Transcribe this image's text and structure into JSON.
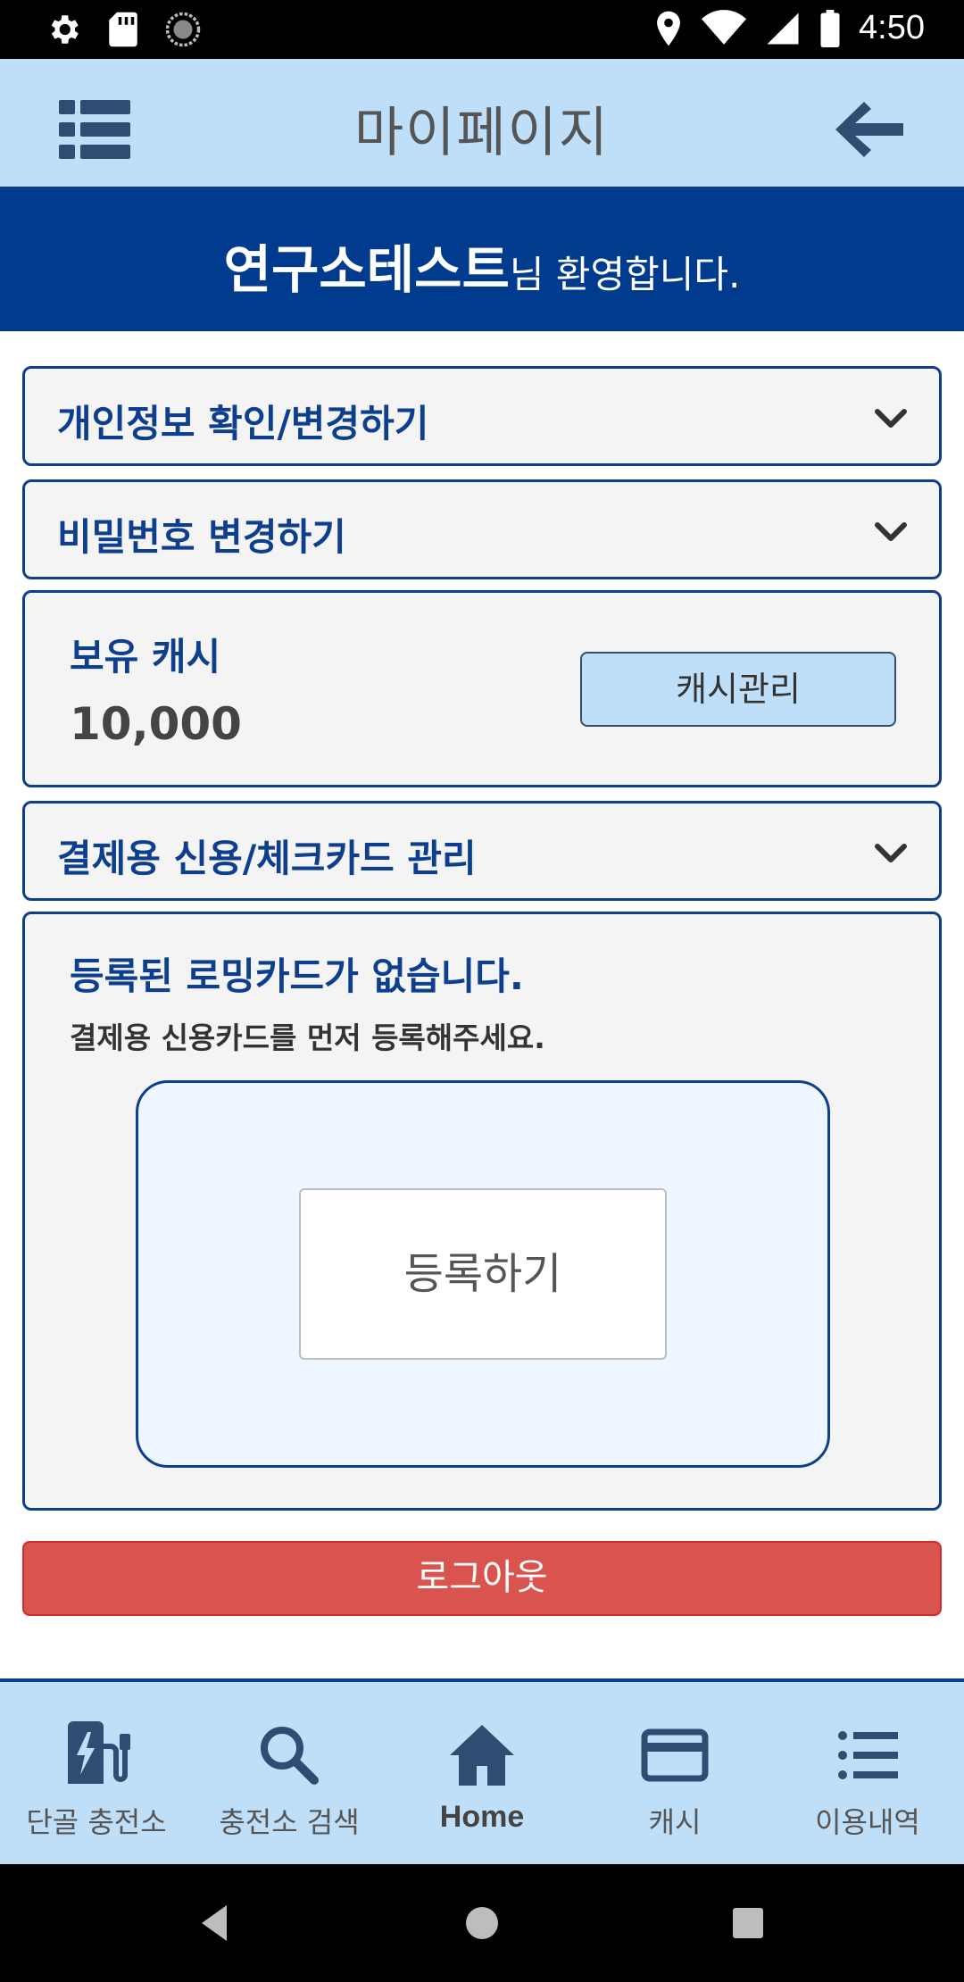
{
  "status_bar": {
    "time": "4:50",
    "left_icons": [
      "settings-icon",
      "sd-card-icon",
      "sync-icon"
    ],
    "right_icons": [
      "location-icon",
      "wifi-icon",
      "signal-icon",
      "battery-icon"
    ]
  },
  "header": {
    "title": "마이페이지",
    "menu_icon": "list-menu-icon",
    "back_icon": "arrow-left-icon"
  },
  "welcome": {
    "name": "연구소테스트",
    "suffix": "님 환영합니다."
  },
  "sections": {
    "personal_info": "개인정보 확인/변경하기",
    "password": "비밀번호 변경하기",
    "cash": {
      "title": "보유 캐시",
      "amount": "10,000",
      "manage_button": "캐시관리"
    },
    "card_manage": "결제용 신용/체크카드 관리",
    "roaming": {
      "title": "등록된 로밍카드가 없습니다.",
      "subtitle": "결제용 신용카드를 먼저 등록해주세요.",
      "register_button": "등록하기"
    }
  },
  "logout": "로그아웃",
  "bottom_nav": [
    {
      "label": "단골 충전소",
      "icon": "ev-charger-icon",
      "active": false
    },
    {
      "label": "충전소 검색",
      "icon": "search-icon",
      "active": false
    },
    {
      "label": "Home",
      "icon": "home-icon",
      "active": true
    },
    {
      "label": "캐시",
      "icon": "credit-card-icon",
      "active": false
    },
    {
      "label": "이용내역",
      "icon": "list-icon",
      "active": false
    }
  ],
  "colors": {
    "header_bg": "#bfdff8",
    "banner_bg": "#003b8e",
    "accent": "#0d3f8e",
    "logout": "#d9534f"
  }
}
